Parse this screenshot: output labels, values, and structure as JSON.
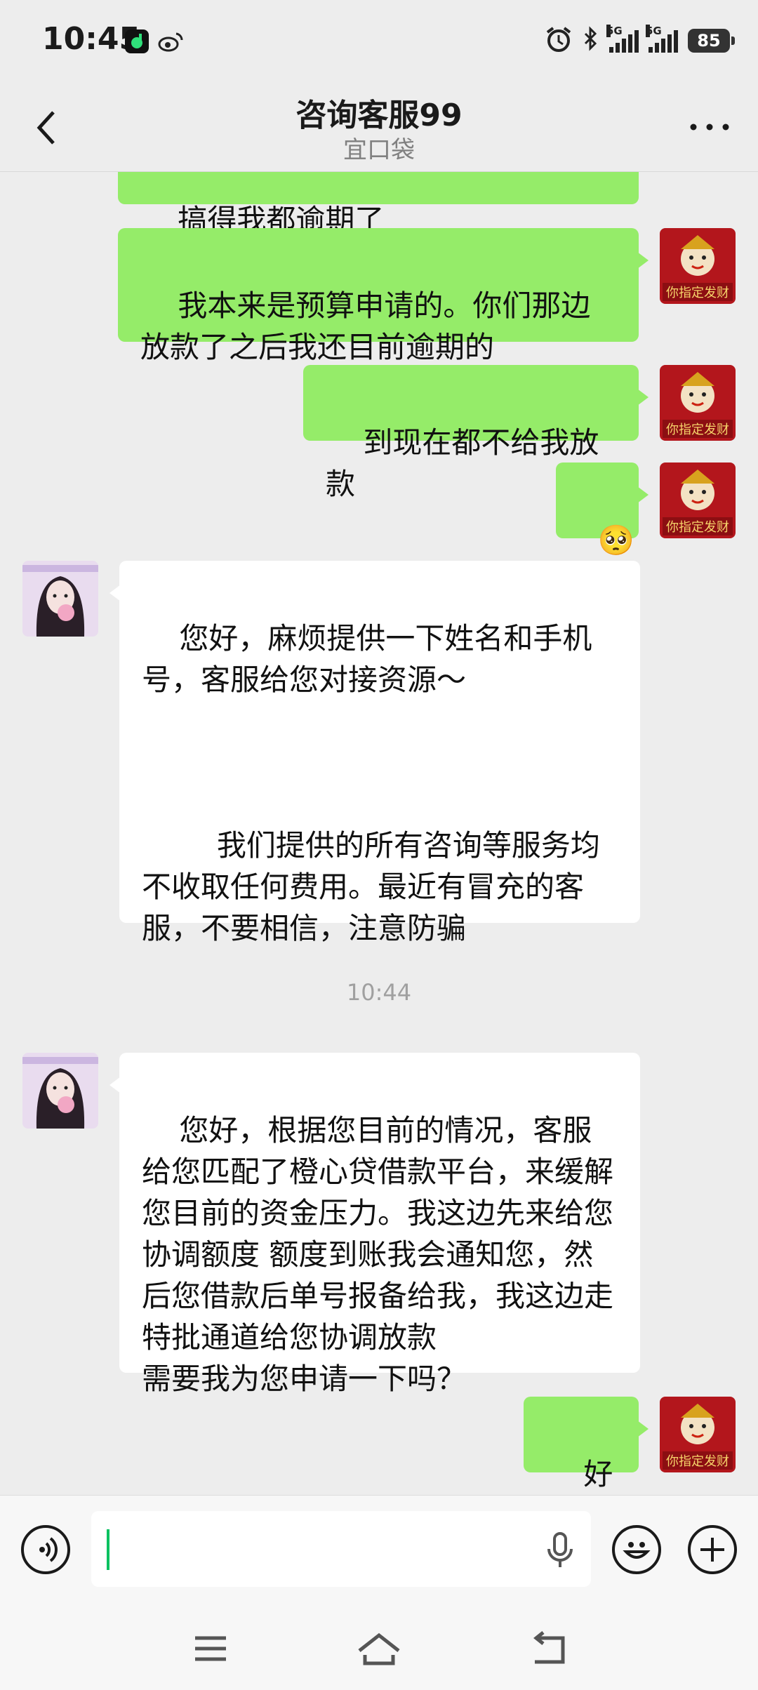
{
  "status_bar": {
    "time": "10:45",
    "signal_1_label": "5G",
    "signal_2_label": "5G",
    "battery": "85",
    "icons": [
      "music-app-icon",
      "weibo-icon",
      "alarm-icon",
      "bluetooth-icon",
      "signal-icon",
      "signal-icon",
      "battery-icon"
    ]
  },
  "header": {
    "title": "咨询客服99",
    "subtitle": "宜口袋"
  },
  "messages": [
    {
      "side": "right",
      "text": "搞得我都逾期了"
    },
    {
      "side": "right",
      "text": "我本来是预算申请的。你们那边放款了之后我还目前逾期的"
    },
    {
      "side": "right",
      "text": "到现在都不给我放款"
    },
    {
      "side": "right",
      "text": "🥺"
    },
    {
      "side": "left",
      "text": "您好，麻烦提供一下姓名和手机号，客服给您对接资源～\n\n\n\n        我们提供的所有咨询等服务均不收取任何费用。最近有冒充的客服，不要相信，注意防骗"
    },
    {
      "side": "time",
      "text": "10:44"
    },
    {
      "side": "left",
      "text": "您好，根据您目前的情况，客服给您匹配了橙心贷借款平台，来缓解您目前的资金压力。我这边先来给您协调额度 额度到账我会通知您，然后您借款后单号报备给我，我这边走特批通道给您协调放款\n需要我为您申请一下吗？"
    },
    {
      "side": "right",
      "text": "好👌🏻"
    }
  ],
  "avatar_self_text": "你指定发财",
  "colors": {
    "background": "#ededed",
    "bubble_self": "#95ec69",
    "bubble_other": "#ffffff",
    "caret": "#07c160"
  }
}
